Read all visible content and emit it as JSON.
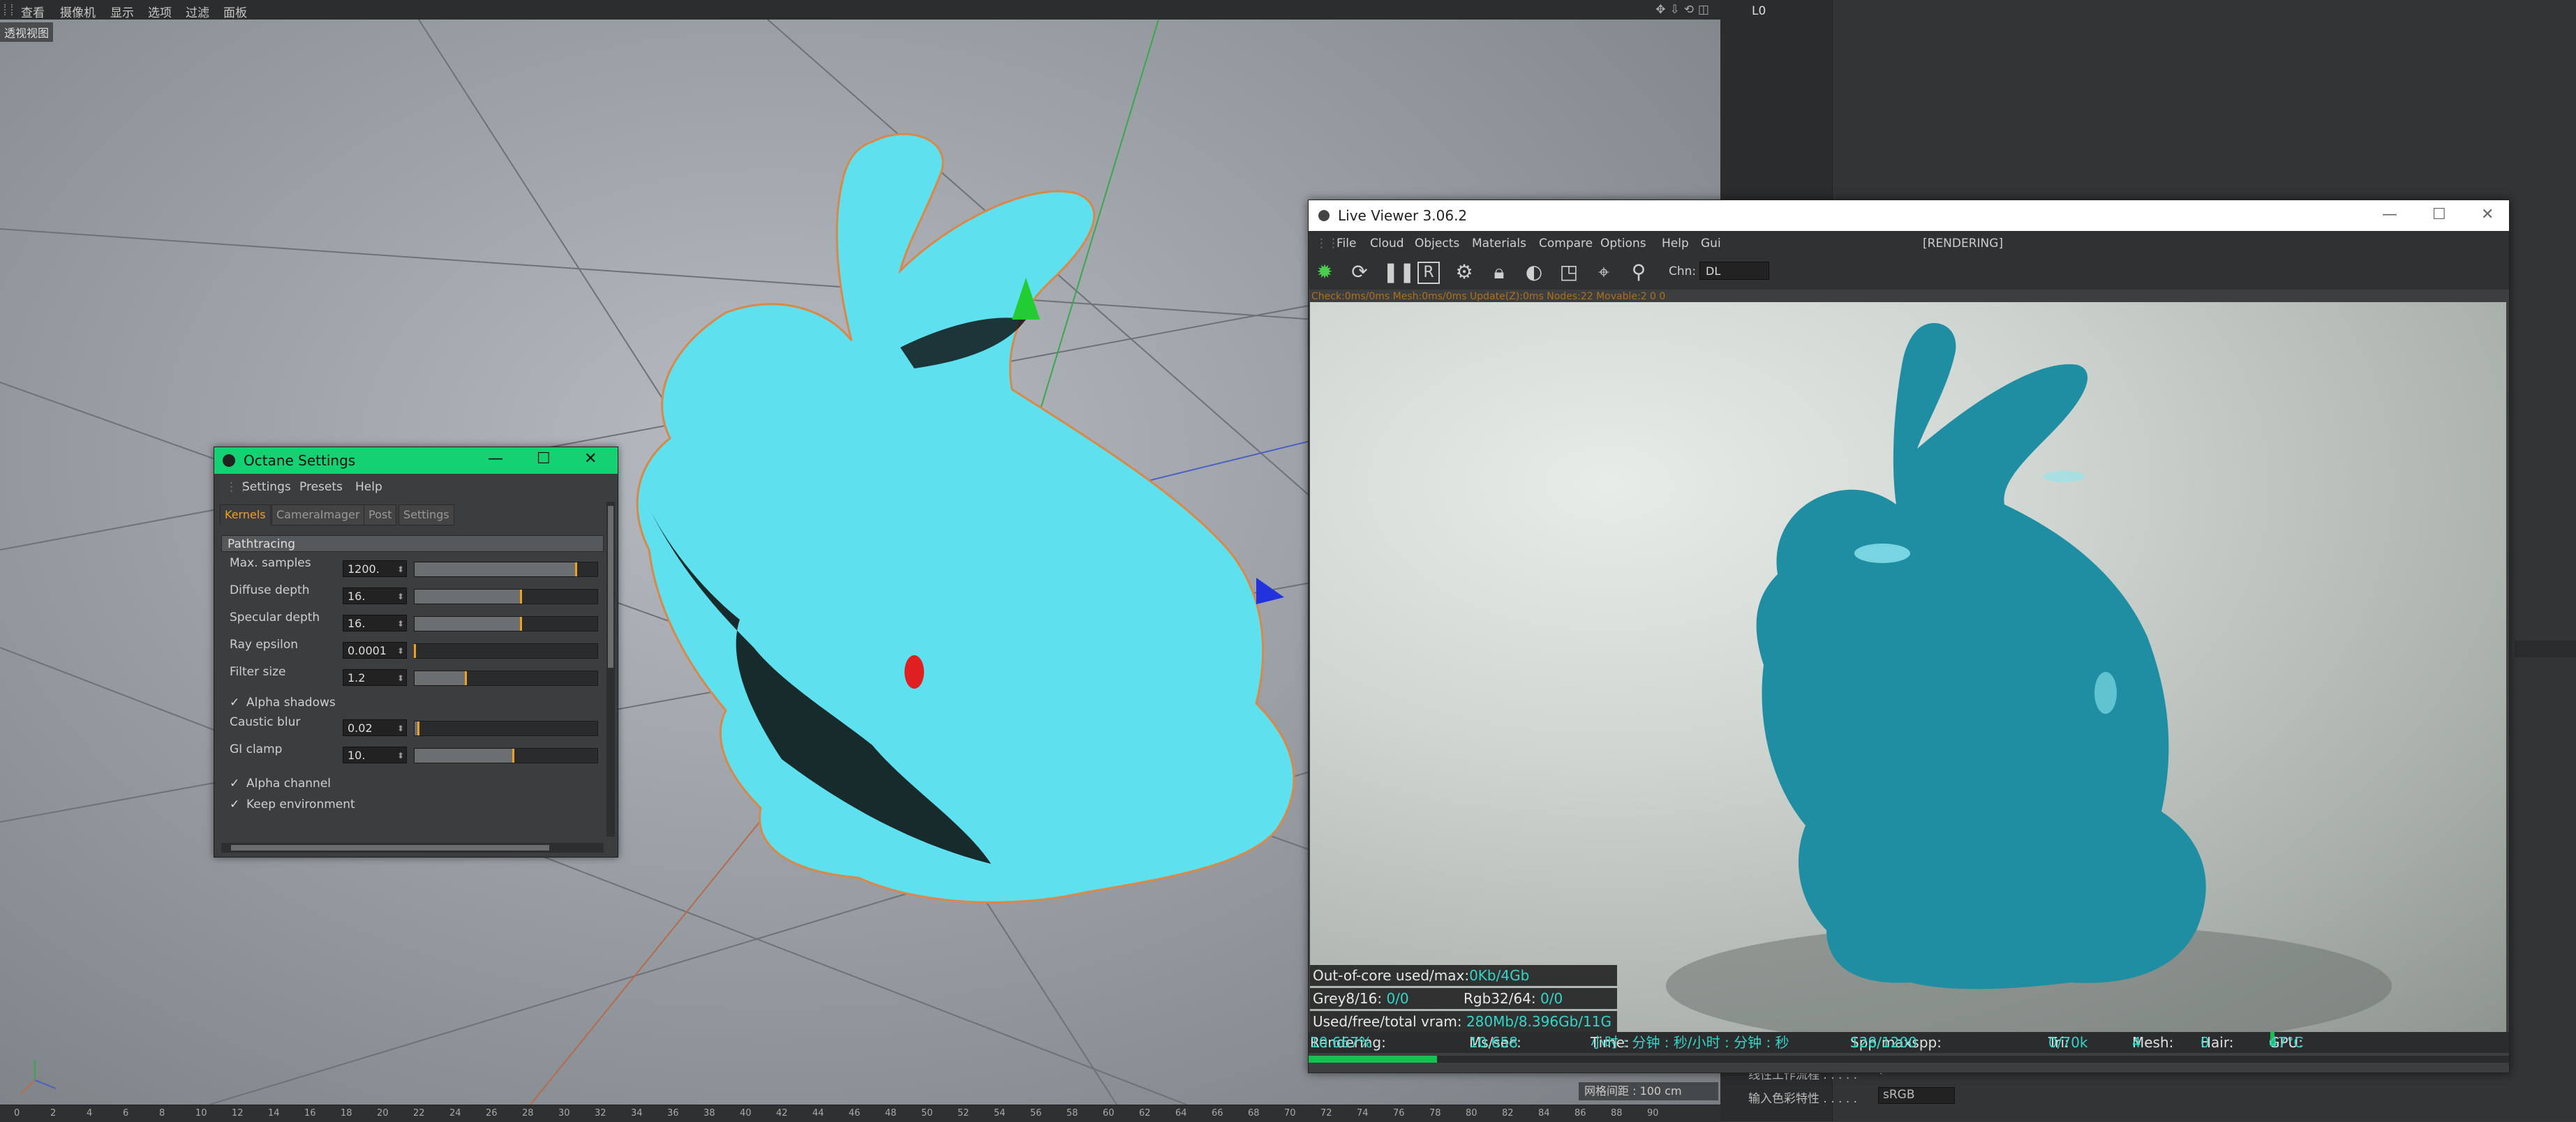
{
  "host_menu": {
    "items": [
      "查看",
      "摄像机",
      "显示",
      "选项",
      "过滤",
      "面板"
    ]
  },
  "viewport": {
    "label": "透视视图",
    "grid_info": "网格间距 : 100 cm"
  },
  "timeline": {
    "ticks": [
      "0",
      "2",
      "4",
      "6",
      "8",
      "10",
      "12",
      "14",
      "16",
      "18",
      "20",
      "22",
      "24",
      "26",
      "28",
      "30",
      "32",
      "34",
      "36",
      "38",
      "40",
      "42",
      "44",
      "46",
      "48",
      "50",
      "52",
      "54",
      "56",
      "58",
      "60",
      "62",
      "64",
      "66",
      "68",
      "70",
      "72",
      "74",
      "76",
      "78",
      "80",
      "82",
      "84",
      "86",
      "88",
      "90"
    ]
  },
  "right_panel": {
    "top_label": "L0",
    "attr_rows": [
      {
        "label": "线性工作流程 . . . . .",
        "value": "✓"
      },
      {
        "label": "输入色彩特性 . . . . .",
        "value": "sRGB"
      }
    ]
  },
  "octane_settings": {
    "title": "Octane Settings",
    "menu": [
      "Settings",
      "Presets",
      "Help"
    ],
    "tabs": [
      {
        "label": "Kernels",
        "active": true
      },
      {
        "label": "CameraImager",
        "active": false
      },
      {
        "label": "Post",
        "active": false
      },
      {
        "label": "Settings",
        "active": false
      }
    ],
    "section": "Pathtracing",
    "params": [
      {
        "label": "Max. samples",
        "value": "1200.",
        "fill": 0.88
      },
      {
        "label": "Diffuse depth",
        "value": "16.",
        "fill": 0.58
      },
      {
        "label": "Specular depth",
        "value": "16.",
        "fill": 0.58
      },
      {
        "label": "Ray epsilon",
        "value": "0.0001",
        "fill": 0.0
      },
      {
        "label": "Filter size",
        "value": "1.2",
        "fill": 0.28
      }
    ],
    "check1": {
      "check": "✓",
      "label": "Alpha shadows"
    },
    "params2": [
      {
        "label": "Caustic blur",
        "value": "0.02",
        "fill": 0.02
      },
      {
        "label": "GI clamp",
        "value": "10.",
        "fill": 0.54
      }
    ],
    "checks": [
      {
        "check": "✓",
        "label": "Alpha channel"
      },
      {
        "check": "✓",
        "label": "Keep environment"
      }
    ]
  },
  "live_viewer": {
    "title": "Live Viewer 3.06.2",
    "menu": [
      "File",
      "Cloud",
      "Objects",
      "Materials",
      "Compare",
      "Options",
      "Help",
      "Gui"
    ],
    "status": "[RENDERING]",
    "channel_label": "Chn:",
    "channel_value": "DL",
    "info_line": "Check:0ms/0ms  Mesh:0ms/0ms  Update(Z):0ms  Nodes:22 Movable:2  0 0",
    "overlay": {
      "ooc_label": "Out-of-core used/max:",
      "ooc_value": "0Kb/4Gb",
      "grey_label": "Grey8/16: ",
      "grey_value": "0/0",
      "rgb_label": "Rgb32/64: ",
      "rgb_value": "0/0",
      "vram_label": "Used/free/total vram: ",
      "vram_value": "280Mb/8.396Gb/11G"
    },
    "statusbar": {
      "rendering_label": "Rendering: ",
      "rendering_value": "10.667%",
      "ms_label": "Ms/sec: ",
      "ms_value": "10.658",
      "time_label": "Time: ",
      "time_value": "小时 : 分钟 : 秒/小时 : 分钟 : 秒",
      "spp_label": "Spp/maxspp: ",
      "spp_value": "128/1200",
      "tri_label": "Tri: ",
      "tri_value": "0/70k",
      "mesh_label": "Mesh: ",
      "mesh_value": "4",
      "hair_label": "Hair: ",
      "hair_value": "0",
      "gpu_label": "GPU: ",
      "gpu_value": "47°C"
    },
    "progress": 0.107
  },
  "colors": {
    "octane_green": "#14d173",
    "accent_orange": "#f0a020",
    "cyan_text": "#34d6c8",
    "bunny_viewport": "#5ee0ee",
    "bunny_render": "#1f8ea3"
  }
}
